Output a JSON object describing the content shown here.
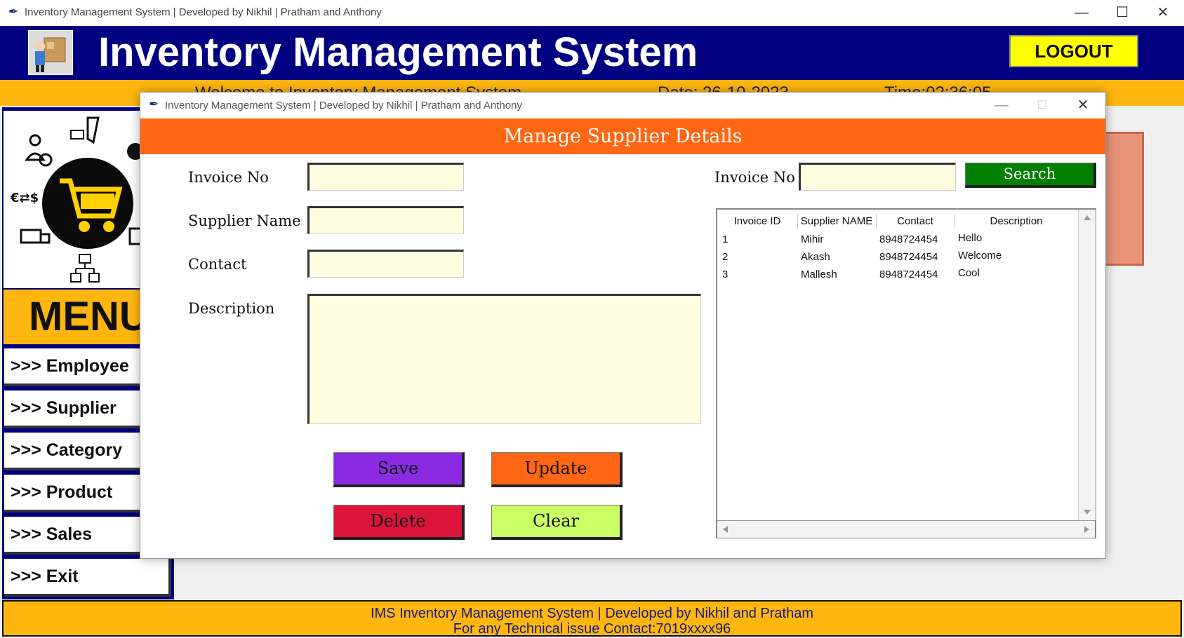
{
  "window": {
    "title": "Inventory Management System | Developed by Nikhil | Pratham and Anthony",
    "minimize": "—",
    "maximize": "☐",
    "close": "✕"
  },
  "header": {
    "title": "Inventory Management System",
    "logout_label": "LOGOUT"
  },
  "welcome_bar": {
    "welcome_text": "Welcome   to  Inventory  Management  System",
    "date_text": "Date: 26-10-2023",
    "time_text": "Time:02:36:05"
  },
  "menu": {
    "title": "MENU",
    "items": [
      {
        "label": ">>> Employee"
      },
      {
        "label": ">>> Supplier"
      },
      {
        "label": ">>> Category"
      },
      {
        "label": ">>> Product"
      },
      {
        "label": ">>> Sales"
      },
      {
        "label": ">>> Exit"
      }
    ]
  },
  "footer": {
    "line1": "IMS  Inventory Management System | Developed by Nikhil and Pratham",
    "line2": "For any Technical issue Contact:7019xxxx96"
  },
  "dialog": {
    "title": "Inventory Management System | Developed by Nikhil | Pratham and Anthony",
    "header": "Manage Supplier Details",
    "form": {
      "invoice_label": "Invoice No",
      "invoice_value": "",
      "supplier_label": "Supplier Name",
      "supplier_value": "",
      "contact_label": "Contact",
      "contact_value": "",
      "description_label": "Description",
      "description_value": ""
    },
    "search": {
      "label": "Invoice No",
      "value": "",
      "button": "Search"
    },
    "buttons": {
      "save": "Save",
      "update": "Update",
      "delete": "Delete",
      "clear": "Clear"
    },
    "table": {
      "columns": [
        "Invoice ID",
        "Supplier NAME",
        "Contact",
        "Description"
      ],
      "rows": [
        [
          "1",
          "Mihir",
          "8948724454",
          "Hello"
        ],
        [
          "2",
          "Akash",
          "8948724454",
          "Welcome"
        ],
        [
          "3",
          "Mallesh",
          "8948724454",
          "Cool"
        ]
      ]
    }
  },
  "colors": {
    "header_bg": "#010080",
    "accent_yellow": "#ffb70f",
    "dialog_header": "#ff6613",
    "save": "#8a2be2",
    "update": "#ff6613",
    "delete": "#dc143c",
    "clear": "#ccff66",
    "search": "#008000"
  }
}
